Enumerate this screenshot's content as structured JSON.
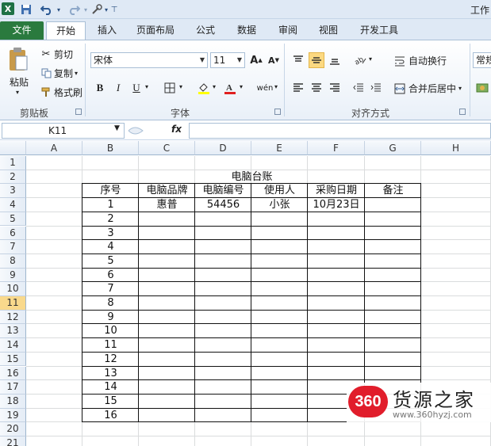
{
  "title_partial": "工作",
  "qat": {
    "logo": "X",
    "save_icon": "save-icon",
    "undo_icon": "undo-icon",
    "redo_icon": "redo-icon",
    "customize_icon": "customize-icon"
  },
  "tabs": [
    "文件",
    "开始",
    "插入",
    "页面布局",
    "公式",
    "数据",
    "审阅",
    "视图",
    "开发工具"
  ],
  "ribbon": {
    "clipboard": {
      "paste": "粘贴",
      "cut": "剪切",
      "copy": "复制",
      "format_painter": "格式刷",
      "label": "剪贴板"
    },
    "font": {
      "name": "宋体",
      "size": "11",
      "bold": "B",
      "italic": "I",
      "underline": "U",
      "label": "字体",
      "grow": "A",
      "shrink": "A",
      "phonetic": "wén"
    },
    "alignment": {
      "wrap": "自动换行",
      "merge": "合并后居中",
      "label": "对齐方式"
    },
    "number": {
      "format": "常规"
    }
  },
  "formula_bar": {
    "name_box": "K11",
    "fx": "fx",
    "value": ""
  },
  "grid": {
    "columns": [
      "A",
      "B",
      "C",
      "D",
      "E",
      "F",
      "G",
      "H"
    ],
    "rows": [
      "1",
      "2",
      "3",
      "4",
      "5",
      "6",
      "7",
      "8",
      "9",
      "10",
      "11",
      "12",
      "13",
      "14",
      "15",
      "16",
      "17",
      "18",
      "19",
      "20",
      "21"
    ],
    "active_row": "11"
  },
  "sheet": {
    "title": "电脑台账",
    "headers": [
      "序号",
      "电脑品牌",
      "电脑编号",
      "使用人",
      "采购日期",
      "备注"
    ],
    "first_row": {
      "brand": "惠普",
      "number": "54456",
      "user": "小张",
      "date": "10月23日"
    },
    "serials": [
      "1",
      "2",
      "3",
      "4",
      "5",
      "6",
      "7",
      "8",
      "9",
      "10",
      "11",
      "12",
      "13",
      "14",
      "15",
      "16"
    ]
  },
  "watermark": {
    "badge": "360",
    "name": "货源之家",
    "url": "www.360hyzj.com"
  }
}
